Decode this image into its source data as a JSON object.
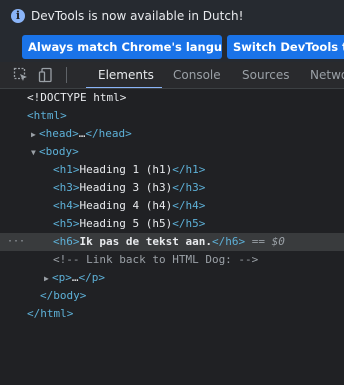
{
  "infobar": {
    "message": "DevTools is now available in Dutch!"
  },
  "buttons": {
    "match_language": "Always match Chrome's language",
    "switch_devtools": "Switch DevTools to Dutch"
  },
  "tabs": [
    "Elements",
    "Console",
    "Sources",
    "Network"
  ],
  "active_tab": "Elements",
  "tree": {
    "doctype": "<!DOCTYPE html>",
    "html_open": "<html>",
    "head_open": "<head>",
    "head_ellipsis": "…",
    "head_close": "</head>",
    "body_open": "<body>",
    "h1_open": "<h1>",
    "h1_text": "Heading 1 (h1)",
    "h1_close": "</h1>",
    "h3_open": "<h3>",
    "h3_text": "Heading 3 (h3)",
    "h3_close": "</h3>",
    "h4_open": "<h4>",
    "h4_text": "Heading 4 (h4)",
    "h4_close": "</h4>",
    "h5_open": "<h5>",
    "h5_text": "Heading 5 (h5)",
    "h5_close": "</h5>",
    "h6_open": "<h6>",
    "h6_text": "Ik pas de tekst aan.",
    "h6_close": "</h6>",
    "h6_marker": " == $0",
    "gutter_dots": "···",
    "comment": "<!-- Link back to HTML Dog: -->",
    "p_open": "<p>",
    "p_ellipsis": "…",
    "p_close": "</p>",
    "body_close": "</body>",
    "html_close": "</html>"
  },
  "colors": {
    "accent": "#8ab4f8",
    "button_bg": "#1a73e8",
    "tag": "#5db0d7",
    "panel_bg": "#202124",
    "selected_row": "#393b3d"
  }
}
